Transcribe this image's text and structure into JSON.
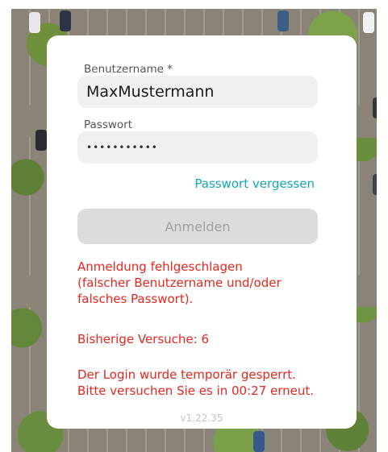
{
  "login": {
    "username_label": "Benutzername *",
    "username_value": "MaxMustermann",
    "password_label": "Passwort",
    "password_value": "•••••••••••",
    "forgot_password": "Passwort vergessen",
    "submit_label": "Anmelden"
  },
  "messages": {
    "error_lines": [
      "Anmeldung fehlgeschlagen",
      "(falscher Benutzername und/oder",
      "falsches Passwort)."
    ],
    "attempts": "Bisherige Versuche: 6",
    "lockout_lines": [
      "Der Login wurde temporär gesperrt.",
      "Bitte versuchen Sie es in 00:27 erneut."
    ]
  },
  "footer": {
    "version": "v1.22.35"
  },
  "colors": {
    "accent": "#12a7b6",
    "error": "#e5281e",
    "disabled_button": "#dcdcdc"
  }
}
